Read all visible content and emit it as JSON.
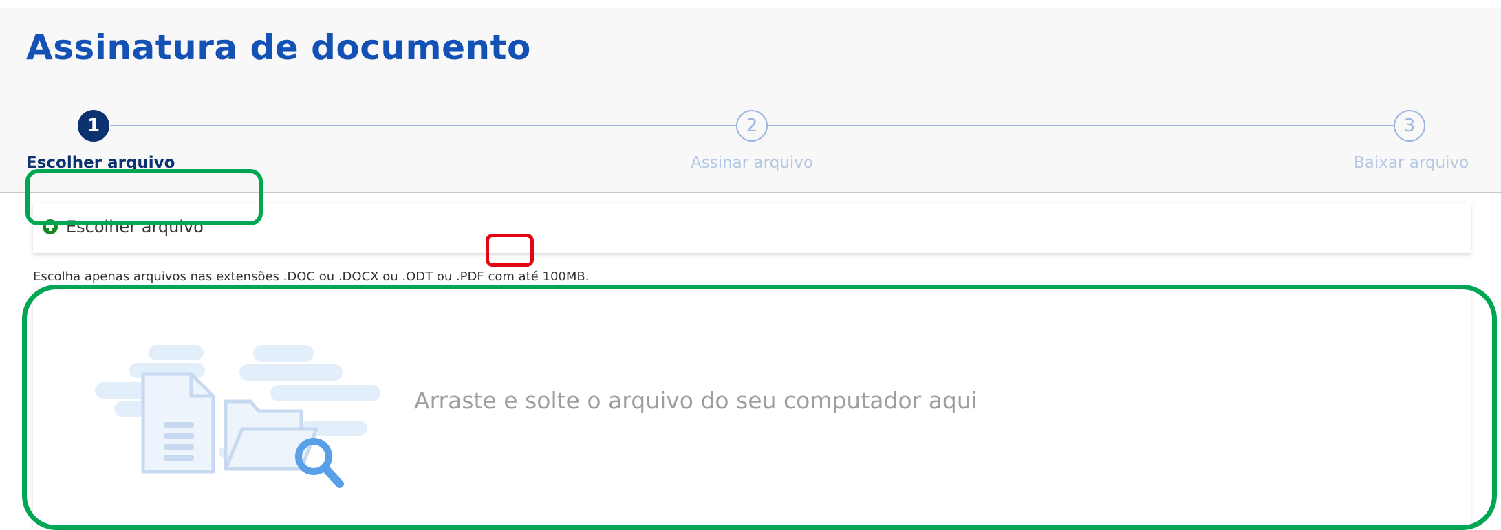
{
  "page": {
    "title": "Assinatura de documento"
  },
  "steps": [
    {
      "number": "1",
      "label": "Escolher arquivo",
      "state": "active"
    },
    {
      "number": "2",
      "label": "Assinar arquivo",
      "state": "inactive"
    },
    {
      "number": "3",
      "label": "Baixar arquivo",
      "state": "inactive"
    }
  ],
  "upload": {
    "button_label": "Escolher arquivo",
    "help_text": "Escolha apenas arquivos nas extensões .DOC ou .DOCX ou .ODT ou .PDF com até 100MB.",
    "dropzone_text": "Arraste e solte o arquivo do seu computador aqui"
  },
  "icons": {
    "upload_button": "plus-circle-icon",
    "dropzone": "file-search-illustration"
  },
  "colors": {
    "primary_blue": "#1351b4",
    "dark_blue": "#0c326f",
    "step_inactive": "#9ab6dc",
    "success_green": "#168821",
    "annotation_green": "#00a651",
    "annotation_red": "#e30613"
  }
}
